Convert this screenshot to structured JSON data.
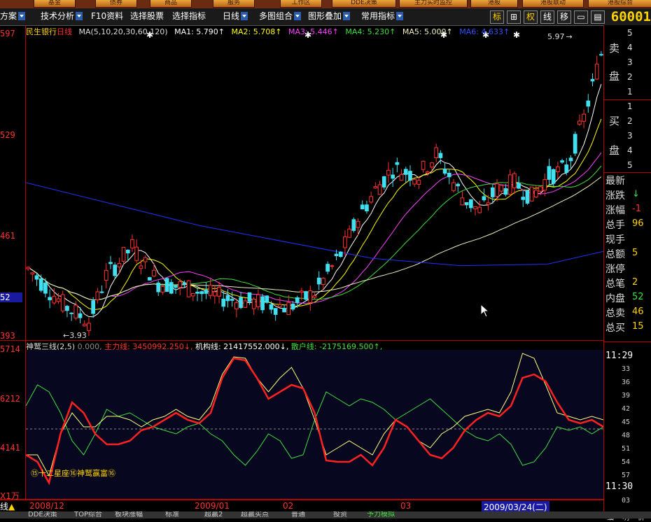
{
  "top_menu": [
    "基金",
    "债券",
    "商品",
    "服务",
    "工作区",
    "DDE决策",
    "主力实时监控",
    "港股",
    "港股联动",
    "港股综合"
  ],
  "toolbar": {
    "plan": "方案",
    "tech": "技术分析",
    "f10": "F10资料",
    "pick_stock": "选择股票",
    "pick_index": "选择指标",
    "period": "日线",
    "multi": "多图组合",
    "overlay": "图形叠加",
    "common": "常用指标",
    "btn_biao": "标",
    "btn_quan": "权",
    "btn_xian": "线",
    "btn_yi": "移",
    "stock_code": "60001"
  },
  "main_legend": {
    "name": "民生银行",
    "period": "日线",
    "ma_setting": "MA(5,10,20,30,60,120)",
    "ma1": "MA1: 5.790↑",
    "ma2": "MA2: 5.708↑",
    "ma3": "MA3: 5.446↑",
    "ma4": "MA4: 5.230↑",
    "ma5": "MA5: 5.000↑",
    "ma6": "MA6: 4.633↑"
  },
  "annotations": {
    "high": "5.97",
    "low": "3.93"
  },
  "y_axis_main": [
    "597",
    "529",
    "461",
    "52",
    "393"
  ],
  "sub_legend": {
    "name": "神鹫三线",
    "param": "(2,5)",
    "base": "0.000,",
    "main": "主力线: 3450992.250↓,",
    "inst": "机构线: 21417552.000↓,",
    "retail": "散户线: -2175169.500↑,"
  },
  "y_axis_sub": [
    "5714",
    "6212",
    "4141"
  ],
  "sub_tag": "⑮十二星座⑯神鹫赢富⑯",
  "y_unit": "X1万",
  "dates": [
    "2008/12",
    "2009/01",
    "02",
    "03",
    "2009/03/24(二)"
  ],
  "right_panel": {
    "sell_label_1": "卖",
    "sell_label_2": "盘",
    "buy_label_1": "买",
    "buy_label_2": "盘",
    "sell_nums": [
      "5",
      "4",
      "3",
      "2",
      "1"
    ],
    "buy_nums": [
      "1",
      "2",
      "3",
      "4",
      "5"
    ],
    "stats": [
      {
        "label": "最新",
        "value": ""
      },
      {
        "label": "涨跌",
        "value": "↓"
      },
      {
        "label": "涨幅",
        "value": "-1"
      },
      {
        "label": "总手",
        "value": "96"
      },
      {
        "label": "现手",
        "value": ""
      },
      {
        "label": "总额",
        "value": "5"
      },
      {
        "label": "涨停",
        "value": ""
      },
      {
        "label": "总笔",
        "value": "2"
      },
      {
        "label": "内盘",
        "value": "52"
      },
      {
        "label": "总卖",
        "value": "46"
      },
      {
        "label": "总买",
        "value": "15"
      }
    ],
    "times": [
      "11:29",
      "33",
      "36",
      "39",
      "42",
      "45",
      "48",
      "51",
      "54",
      "57",
      "11:30",
      "03"
    ],
    "bottom": [
      "细",
      "明",
      "价"
    ]
  },
  "bottom_bar": [
    "线▲",
    "DDE决策",
    "TOP综合",
    "板块涨幅",
    "标准",
    "超赢2",
    "超赢买点",
    "普通",
    "投资",
    "予力模拟"
  ],
  "colors": {
    "up": "#ff3030",
    "down": "#40e0f0",
    "ma1": "#ffffff",
    "ma2": "#ffff00",
    "ma3": "#ff40ff",
    "ma4": "#40e040",
    "ma5": "#f0f0c0",
    "ma6": "#2030ff",
    "grid": "#b00000"
  }
}
